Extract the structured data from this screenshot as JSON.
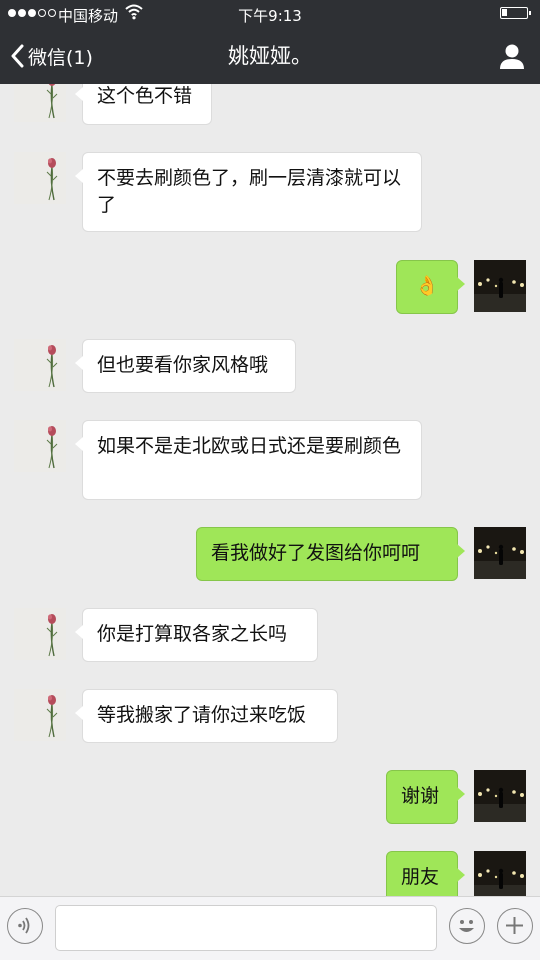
{
  "status_bar": {
    "carrier": "中国移动",
    "time": "下午9:13",
    "signal_bars_filled": 3,
    "signal_bars_total": 5,
    "battery_level": 0.2
  },
  "nav": {
    "back_label": "微信(1)",
    "title": "姚娅娅。",
    "back_icon": "chevron-left-icon",
    "profile_icon": "person-icon"
  },
  "messages": [
    {
      "side": "left",
      "text": "这个色不错"
    },
    {
      "side": "left",
      "text": "不要去刷颜色了，刷一层清漆就可以了"
    },
    {
      "side": "right",
      "text": "👌"
    },
    {
      "side": "left",
      "text": "但也要看你家风格哦"
    },
    {
      "side": "left",
      "text": "如果不是走北欧或日式还是要刷颜色"
    },
    {
      "side": "right",
      "text": "看我做好了发图给你呵呵"
    },
    {
      "side": "left",
      "text": "你是打算取各家之长吗"
    },
    {
      "side": "left",
      "text": "等我搬家了请你过来吃饭"
    },
    {
      "side": "right",
      "text": "谢谢"
    },
    {
      "side": "right",
      "text": "朋友"
    }
  ],
  "input_bar": {
    "voice_icon": "voice-icon",
    "emoji_icon": "emoji-icon",
    "plus_icon": "plus-icon"
  },
  "colors": {
    "nav_bg": "#2e3034",
    "chat_bg": "#ebebeb",
    "sent_bubble": "#9fe658",
    "received_bubble": "#ffffff"
  }
}
